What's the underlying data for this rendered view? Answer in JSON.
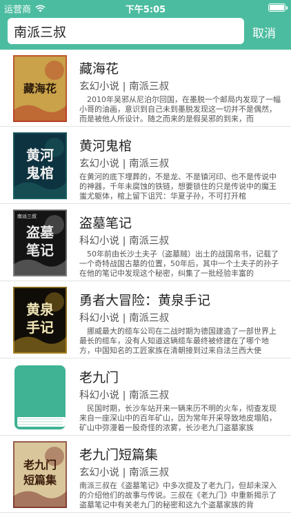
{
  "status": {
    "carrier": "运营商",
    "time": "下午5:05",
    "battery_level": 1.0
  },
  "search": {
    "value": "南派三叔",
    "cancel_label": "取消"
  },
  "results": [
    {
      "title": "藏海花",
      "meta": "玄幻小说 | 南派三叔",
      "description": "　2010年吴邪从尼泊尔回国，在墨脱一个邮局内发现了一幅小哥的油画，意识到自己未到墨脱发现这一切并不是偶然，而是被他人所设计。随之而来的是假吴邪的到来，而",
      "cover_lines": [
        "藏海花"
      ],
      "cover_colors": {
        "bg": "#c9a24a",
        "accent": "#b3231d",
        "text": "#2a1a0c"
      },
      "cover_icon": "book-cover-icon"
    },
    {
      "title": "黄河鬼棺",
      "meta": "玄幻小说 | 南派三叔",
      "description": "在黄河的底下埋葬的，不是龙、不是镇河印、也不是传说中的神器，千年未腐蚀的铁链，想要锁住的只是传说中的魔王蚩尤躯体，棺上留下诅咒：华夏子孙，不可打开棺",
      "cover_lines": [
        "黄河",
        "鬼棺"
      ],
      "cover_colors": {
        "bg": "#0e3340",
        "accent": "#1f6d6a",
        "text": "#f1f1f1"
      },
      "cover_icon": "book-cover-icon"
    },
    {
      "title": "盗墓笔记",
      "meta": "科幻小说 | 南派三叔",
      "description": "　50年前由长沙土夫子（盗墓贼）出土的战国帛书，记载了一个奇特战国古墓的位置，50年后，其中一个土夫子的孙子在他的笔记中发现这个秘密，纠集了一批经验丰富的",
      "cover_lines": [
        "盗墓",
        "笔记"
      ],
      "cover_colors": {
        "bg": "#141414",
        "accent": "#9a9a9a",
        "text": "#e7e7e7"
      },
      "cover_small": "南派三叔",
      "cover_icon": "book-cover-icon"
    },
    {
      "title": "勇者大冒险：黄泉手记",
      "meta": "科幻小说 | 南派三叔",
      "description": "　挪威最大的缆车公司在二战时期为德国建造了一部世界上最长的缆车，没有人知道这辆缆车最终被修建在了哪个地方，中国知名的工匠家族在清朝接到过来自法兰西大使",
      "cover_lines": [
        "黄泉",
        "手记"
      ],
      "cover_colors": {
        "bg": "#100d08",
        "accent": "#d2a42a",
        "text": "#f2e6b6"
      },
      "cover_icon": "book-cover-icon"
    },
    {
      "title": "老九门",
      "meta": "科幻小说 | 南派三叔",
      "description": "　民国时期，长沙车站开来一辆来历不明的火车，彻查发现来自一座深山中的百年矿山，因为常年开采导致地皮塌陷，矿山中弥漫着一股奇怪的浓雾，长沙老九门盗墓家族",
      "cover_lines": [],
      "cover_colors": {
        "bg": "#ffffff",
        "accent": "#3fb394",
        "text": "#ffffff"
      },
      "cover_icon": "book-placeholder-icon"
    },
    {
      "title": "老九门短篇集",
      "meta": "玄幻小说 | 南派三叔",
      "description": "南派三叔在《盗墓笔记》中多次提及了老九门，但却未深入的介绍他们的故事与传说。三叔在《老九门》中重新揭示了盗墓笔记中有关老九门的秘密和这九个盗墓家族的背",
      "cover_lines": [
        "老九门",
        "短篇集"
      ],
      "cover_colors": {
        "bg": "#d9c79b",
        "accent": "#6a1414",
        "text": "#3a1a0a"
      },
      "cover_icon": "book-cover-icon"
    }
  ]
}
